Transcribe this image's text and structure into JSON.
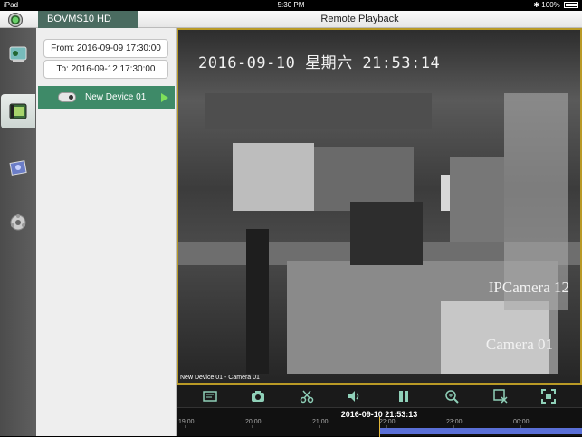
{
  "status_bar": {
    "carrier": "iPad",
    "time": "5:30 PM",
    "battery": "100%"
  },
  "app": {
    "name": "BOVMS10 HD",
    "screen_title": "Remote Playback"
  },
  "panel": {
    "from_label": "From: 2016-09-09 17:30:00",
    "to_label": "To: 2016-09-12 17:30:00",
    "device_name": "New Device 01"
  },
  "rail": [
    "live-view-icon",
    "playback-icon",
    "gallery-icon",
    "settings-icon"
  ],
  "video": {
    "osd_time": "2016-09-10 星期六 21:53:14",
    "osd_camera_line1": "IPCamera 12",
    "osd_camera_line2": "Camera 01",
    "caption": "New Device 01 - Camera 01"
  },
  "toolbar": [
    "record-list-icon",
    "snapshot-icon",
    "clip-icon",
    "volume-icon",
    "pause-icon",
    "zoom-in-icon",
    "stop-all-icon",
    "fullscreen-icon"
  ],
  "timeline": {
    "current": "2016-09-10 21:53:13",
    "labels": [
      "19:00",
      "20:00",
      "21:00",
      "22:00",
      "23:00",
      "00:00"
    ],
    "accent": "#5a6fd6",
    "cursor_color": "#e2b73a"
  }
}
